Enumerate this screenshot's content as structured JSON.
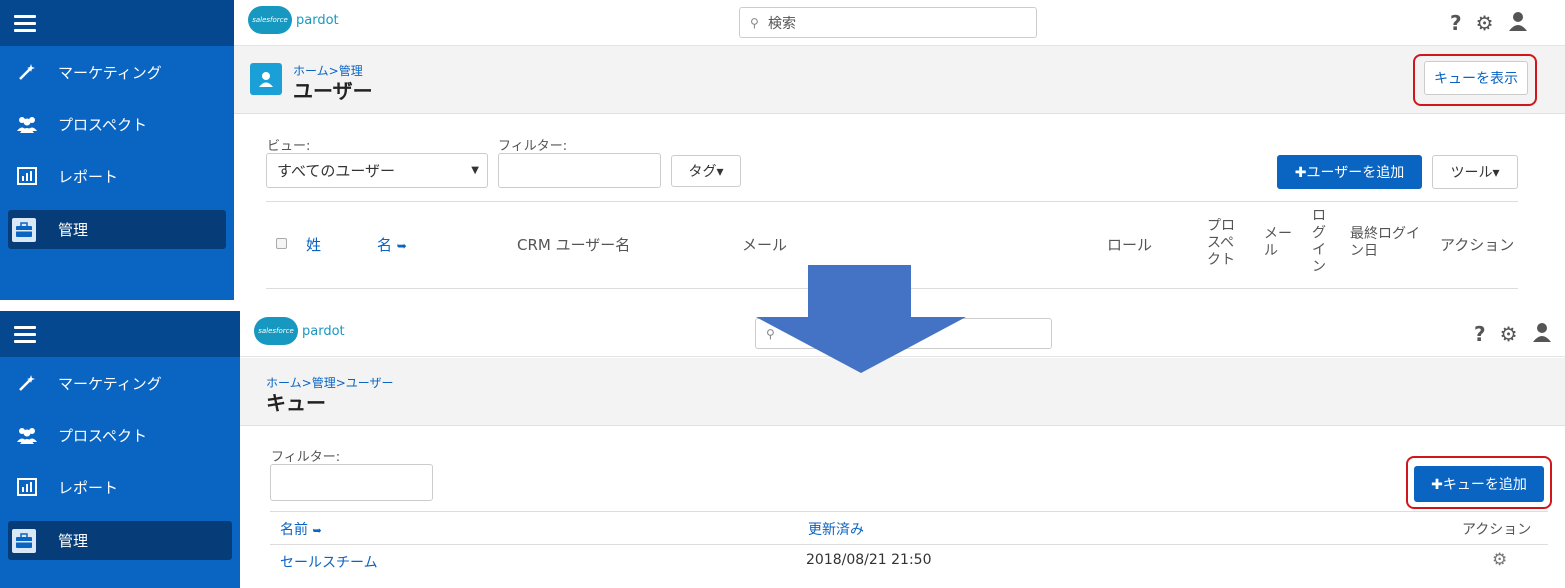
{
  "top": {
    "sidebar": [
      {
        "label": "マーケティング",
        "icon": "magic-wand-icon"
      },
      {
        "label": "プロスペクト",
        "icon": "users-icon"
      },
      {
        "label": "レポート",
        "icon": "report-icon"
      },
      {
        "label": "管理",
        "icon": "briefcase-icon",
        "active": true
      }
    ],
    "logo_cloud": "salesforce",
    "logo_text": "pardot",
    "search_placeholder": "検索",
    "breadcrumb": [
      "ホーム",
      "管理"
    ],
    "breadcrumb_sep": ">",
    "title": "ユーザー",
    "show_queue_button": "キューを表示",
    "view_label": "ビュー:",
    "view_value": "すべてのユーザー",
    "filter_label": "フィルター:",
    "tag_button": "タグ▾",
    "add_user_button": "✚ユーザーを追加",
    "tools_button": "ツール▾",
    "columns": {
      "last_name": "姓",
      "first_name": "名",
      "crm_user": "CRM ユーザー名",
      "email": "メール",
      "role": "ロール",
      "prospect": "プロ\nスペ\nクト",
      "mail": "メー\nル",
      "login": "ロ\nグ\nイ\nン",
      "last_login": "最終ログイ\nン日",
      "actions": "アクション"
    }
  },
  "bottom": {
    "sidebar": [
      {
        "label": "マーケティング",
        "icon": "magic-wand-icon"
      },
      {
        "label": "プロスペクト",
        "icon": "users-icon"
      },
      {
        "label": "レポート",
        "icon": "report-icon"
      },
      {
        "label": "管理",
        "icon": "briefcase-icon",
        "active": true
      }
    ],
    "logo_cloud": "salesforce",
    "logo_text": "pardot",
    "breadcrumb": [
      "ホーム",
      "管理",
      "ユーザー"
    ],
    "breadcrumb_sep": ">",
    "title": "キュー",
    "filter_label": "フィルター:",
    "add_queue_button": "✚キューを追加",
    "columns": {
      "name": "名前",
      "updated": "更新済み",
      "actions": "アクション"
    },
    "rows": [
      {
        "name": "セールスチーム",
        "updated": "2018/08/21 21:50"
      }
    ]
  },
  "colors": {
    "brand_blue": "#0a64c2",
    "sidebar_dark": "#06488f",
    "highlight_red": "#d0161b",
    "arrow": "#4472c4"
  }
}
